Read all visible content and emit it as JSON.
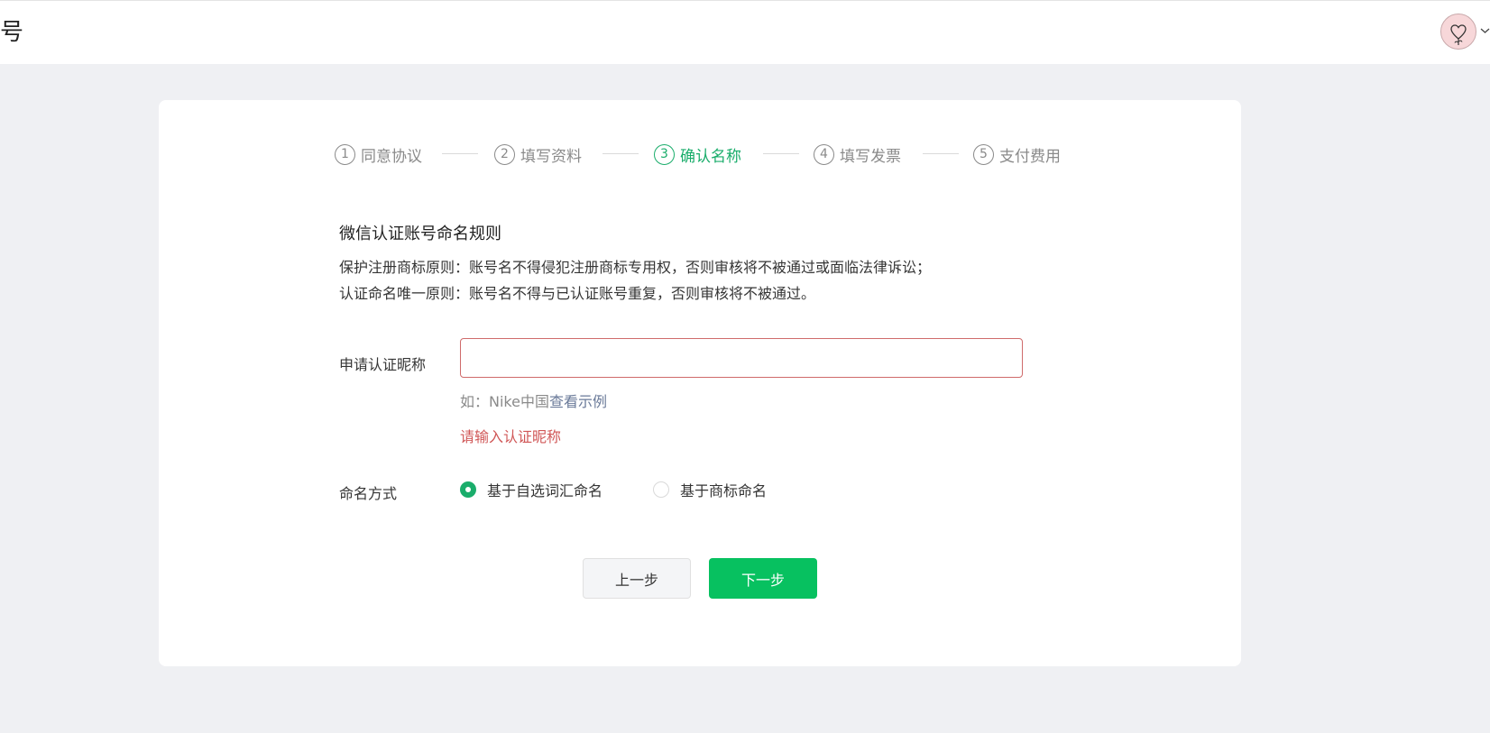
{
  "header": {
    "title": "号"
  },
  "steps": [
    {
      "num": "1",
      "label": "同意协议",
      "active": false
    },
    {
      "num": "2",
      "label": "填写资料",
      "active": false
    },
    {
      "num": "3",
      "label": "确认名称",
      "active": true
    },
    {
      "num": "4",
      "label": "填写发票",
      "active": false
    },
    {
      "num": "5",
      "label": "支付费用",
      "active": false
    }
  ],
  "rules": {
    "title": "微信认证账号命名规则",
    "line1": "保护注册商标原则：账号名不得侵犯注册商标专用权，否则审核将不被通过或面临法律诉讼；",
    "line2": "认证命名唯一原则：账号名不得与已认证账号重复，否则审核将不被通过。"
  },
  "form": {
    "nickname_label": "申请认证昵称",
    "nickname_value": "",
    "hint_prefix": "如：Nike中国",
    "hint_link": "查看示例",
    "error": "请输入认证昵称",
    "naming_label": "命名方式",
    "naming_options": [
      {
        "label": "基于自选词汇命名",
        "selected": true
      },
      {
        "label": "基于商标命名",
        "selected": false
      }
    ]
  },
  "buttons": {
    "prev": "上一步",
    "next": "下一步"
  },
  "colors": {
    "accent": "#1aad6b",
    "primary_button": "#07c160",
    "error": "#d05757",
    "background": "#eff0f3"
  }
}
